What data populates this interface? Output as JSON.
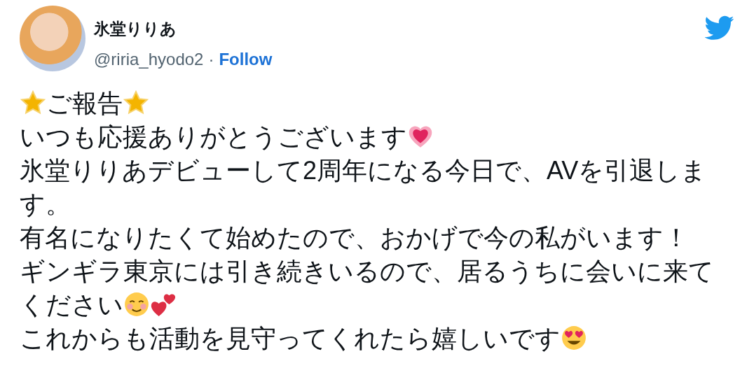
{
  "author": {
    "name": "氷堂りりあ",
    "handle": "@riria_hyodo2",
    "separator": "·",
    "follow": "Follow"
  },
  "lines": [
    {
      "parts": [
        {
          "kind": "star"
        },
        {
          "kind": "text",
          "text": "ご報告"
        },
        {
          "kind": "star"
        }
      ]
    },
    {
      "parts": [
        {
          "kind": "text",
          "text": "いつも応援ありがとうございます"
        },
        {
          "kind": "glowing-heart"
        }
      ]
    },
    {
      "parts": [
        {
          "kind": "text",
          "text": "氷堂りりあデビューして2周年になる今日で、AVを引退します。"
        }
      ]
    },
    {
      "parts": [
        {
          "kind": "text",
          "text": "有名になりたくて始めたので、おかげで今の私がいます！"
        }
      ]
    },
    {
      "parts": [
        {
          "kind": "text",
          "text": "ギンギラ東京には引き続きいるので、居るうちに会いに来て"
        }
      ]
    },
    {
      "parts": [
        {
          "kind": "text",
          "text": "ください"
        },
        {
          "kind": "blush-face"
        },
        {
          "kind": "two-hearts"
        }
      ]
    },
    {
      "parts": [
        {
          "kind": "text",
          "text": "これからも活動を見守ってくれたら嬉しいです"
        },
        {
          "kind": "heart-eyes"
        }
      ]
    }
  ]
}
